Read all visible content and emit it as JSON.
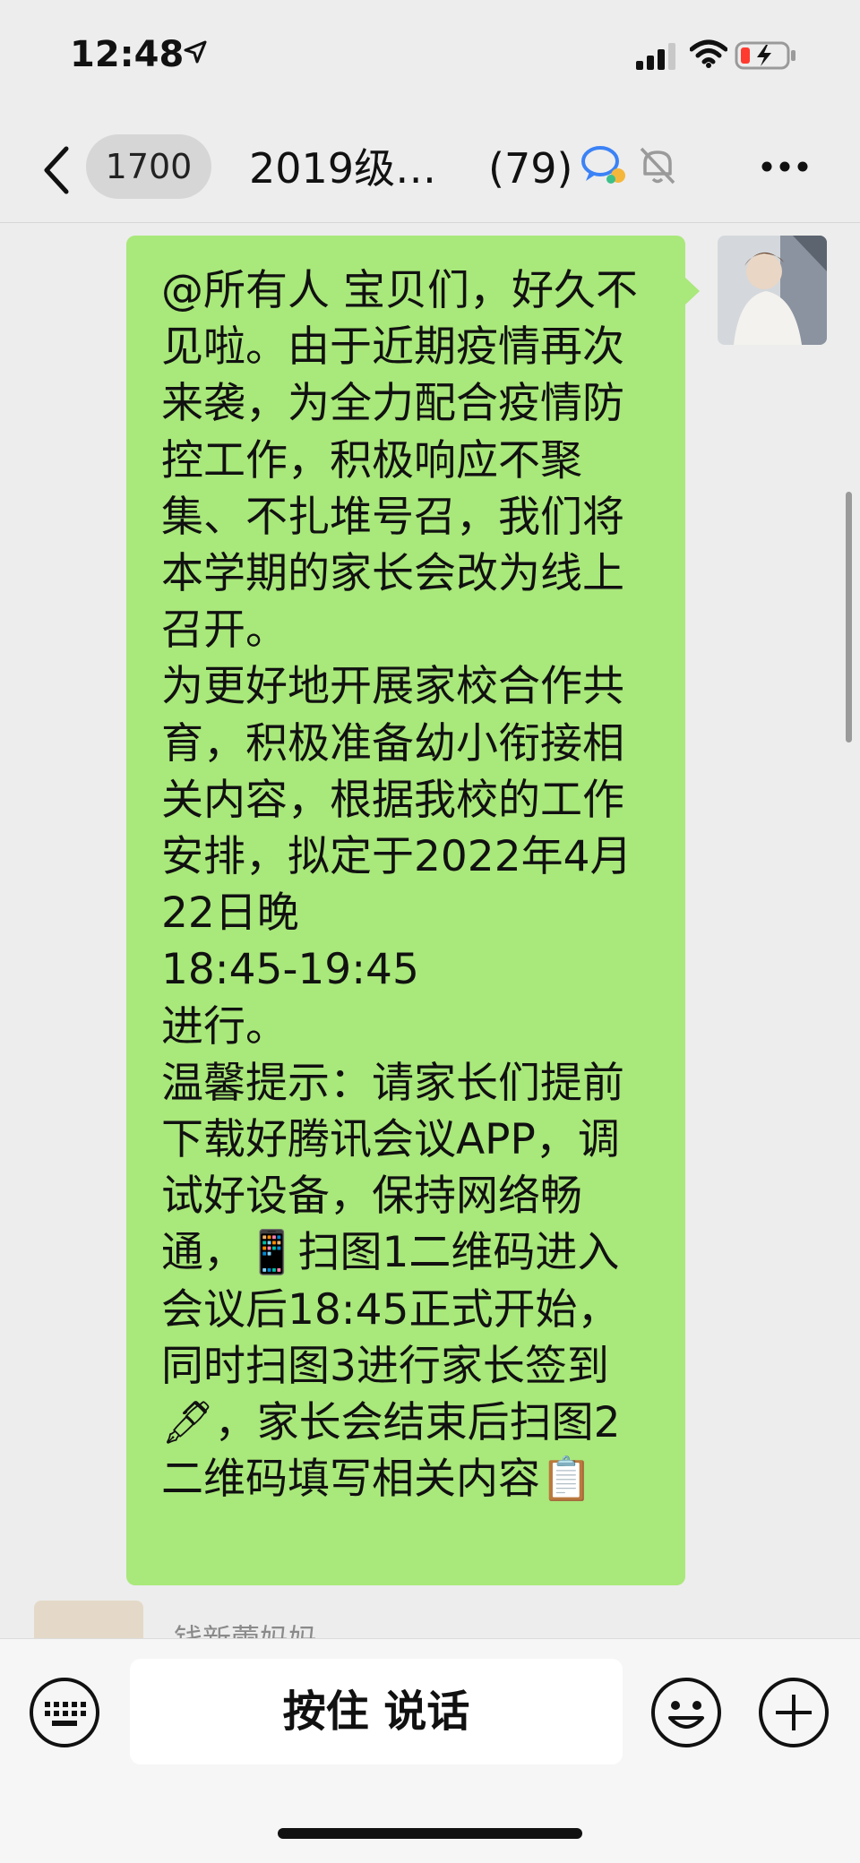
{
  "status_bar": {
    "time": "12:48"
  },
  "nav": {
    "unread_count": "1700",
    "title": "2019级…",
    "member_count": "(79)"
  },
  "message": {
    "text": "@所有人 宝贝们，好久不见啦。由于近期疫情再次来袭，为全力配合疫情防控工作，积极响应不聚集、不扎堆号召，我们将本学期的家长会改为线上召开。\n为更好地开展家校合作共育，积极准备幼小衔接相关内容，根据我校的工作安排，拟定于2022年4月22日晚\n18:45-19:45\n进行。\n温馨提示：请家长们提前下载好腾讯会议APP，调试好设备，保持网络畅通，📱扫图1二维码进入会议后18:45正式开始，同时扫图3进行家长签到🖋，家长会结束后扫图2二维码填写相关内容📋"
  },
  "next_message": {
    "sender": "钱新蕾妈妈"
  },
  "input_bar": {
    "hold_to_talk": "按住 说话"
  },
  "colors": {
    "bubble_green": "#a9e87a",
    "background": "#ededed",
    "input_bar_bg": "#f6f6f6"
  },
  "icons": {
    "status": [
      "location-arrow-icon",
      "signal-icon",
      "wifi-icon",
      "battery-low-icon"
    ],
    "nav": [
      "back-chevron-icon",
      "chat-bubble-icon",
      "mute-bell-icon",
      "more-dots-icon"
    ],
    "input": [
      "keyboard-icon",
      "emoji-icon",
      "plus-icon"
    ]
  }
}
